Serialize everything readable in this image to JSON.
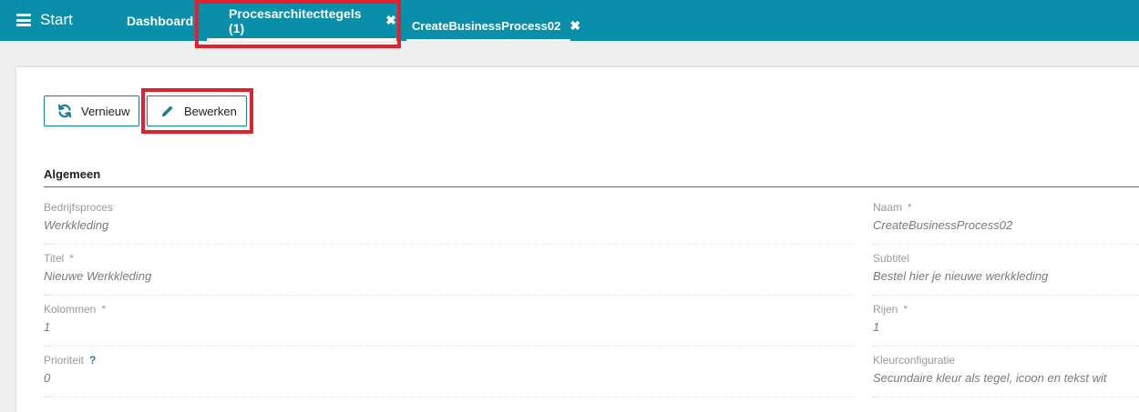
{
  "topbar": {
    "start_label": "Start",
    "tabs": [
      {
        "label": "Dashboard"
      },
      {
        "label": "Procesarchitecttegels (1)",
        "close": "✖"
      },
      {
        "label": "CreateBusinessProcess02",
        "close": "✖"
      }
    ],
    "color": "#0a8fab"
  },
  "toolbar": {
    "refresh_label": "Vernieuw",
    "edit_label": "Bewerken"
  },
  "section": {
    "title": "Algemeen"
  },
  "fields": {
    "bedrijfsproces": {
      "label": "Bedrijfsproces",
      "value": "Werkkleding"
    },
    "naam": {
      "label": "Naam",
      "required": "*",
      "value": "CreateBusinessProcess02"
    },
    "titel": {
      "label": "Titel",
      "required": "*",
      "value": "Nieuwe Werkkleding"
    },
    "subtitel": {
      "label": "Subtitel",
      "value": "Bestel hier je nieuwe werkkleding"
    },
    "kolommen": {
      "label": "Kolommen",
      "required": "*",
      "value": "1"
    },
    "rijen": {
      "label": "Rijen",
      "required": "*",
      "value": "1"
    },
    "prioriteit": {
      "label": "Prioriteit",
      "help": "?",
      "value": "0"
    },
    "kleurconfiguratie": {
      "label": "Kleurconfiguratie",
      "value": "Secundaire kleur als tegel, icoon en tekst wit"
    }
  },
  "highlight_color": "#e4202e"
}
